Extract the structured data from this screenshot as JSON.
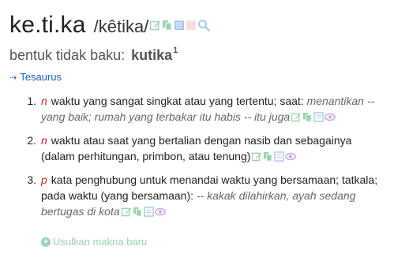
{
  "entry": {
    "word": "ke.ti.ka",
    "pronunciation": "/kêtika/"
  },
  "variant": {
    "label": "bentuk tidak baku:",
    "word": "kutika",
    "superscript": "1"
  },
  "thesaurus": {
    "arrow": "⇢",
    "label": "Tesaurus"
  },
  "definitions": [
    {
      "number": "1.",
      "pos": "n",
      "text": "waktu yang sangat singkat atau yang tertentu; saat:",
      "example": "menantikan -- yang baik; rumah yang terbakar itu habis -- itu juga"
    },
    {
      "number": "2.",
      "pos": "n",
      "text": "waktu atau saat yang bertalian dengan nasib dan sebagainya (dalam perhitungan, primbon, atau tenung)",
      "example": ""
    },
    {
      "number": "3.",
      "pos": "p",
      "text": "kata penghubung untuk menandai waktu yang bersamaan; tatkala; pada waktu (yang bersamaan):",
      "example": "-- kakak dilahirkan, ayah sedang bertugas di kota"
    }
  ],
  "suggest": {
    "icon": "+",
    "label": "Usulkan makna baru"
  },
  "colors": {
    "pos": "#d32020",
    "link": "#1a5fc4",
    "tool_green": "#9ad3b0",
    "tool_purple": "#c9a6e6",
    "tool_blue": "#a8c8ec"
  },
  "icons": [
    "edit-icon",
    "copy-icon",
    "document-icon",
    "bookmark-icon",
    "search-icon",
    "eye-icon",
    "plus-circle-icon"
  ]
}
